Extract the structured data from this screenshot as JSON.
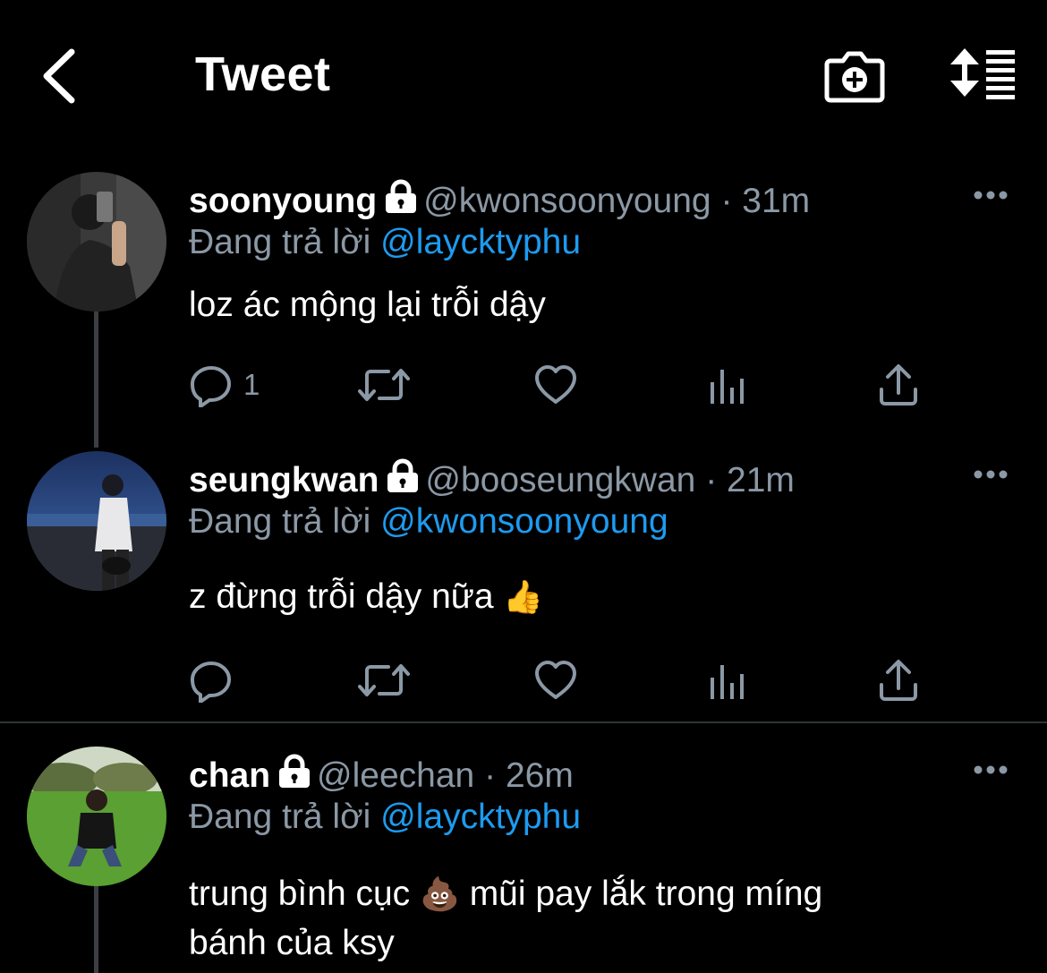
{
  "header": {
    "title": "Tweet",
    "back_icon": "chevron-left-icon",
    "camera_icon": "camera-add-icon",
    "sort_icon": "sort-list-icon"
  },
  "colors": {
    "background": "#000000",
    "text": "#ffffff",
    "muted": "#8b98a5",
    "link": "#1d9bf0",
    "divider": "#2f3336"
  },
  "tweets": [
    {
      "display_name": "soonyoung",
      "handle": "@kwonsoonyoung",
      "separator": "·",
      "time": "31m",
      "replying_prefix": "Đang trả lời",
      "replying_to": "@laycktyphu",
      "text": "loz ác mộng lại trỗi dậy",
      "reply_count": "1"
    },
    {
      "display_name": "seungkwan",
      "handle": "@booseungkwan",
      "separator": "·",
      "time": "21m",
      "replying_prefix": "Đang trả lời",
      "replying_to": "@kwonsoonyoung",
      "text": "z đừng trỗi dậy nữa",
      "emoji": "👍",
      "reply_count": ""
    },
    {
      "display_name": "chan",
      "handle": "@leechan",
      "separator": "·",
      "time": "26m",
      "replying_prefix": "Đang trả lời",
      "replying_to": "@laycktyphu",
      "text_line1_before": "trung bình cục",
      "emoji": "💩",
      "text_line1_after": "mũi pay lắk trong míng",
      "text_line2": "bánh của ksy"
    }
  ]
}
